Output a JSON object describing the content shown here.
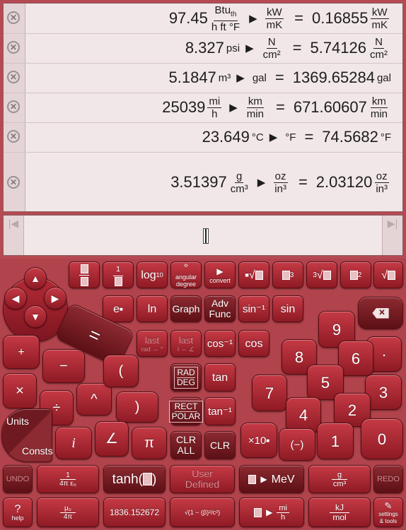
{
  "history": [
    {
      "value": "97.45",
      "from_num": "Btu",
      "from_num_sub": "th",
      "from_den": "h ft °F",
      "to_num": "kW",
      "to_den": "mK",
      "result": "0.16855",
      "res_num": "kW",
      "res_den": "mK"
    },
    {
      "value": "8.327",
      "from_unit": "psi",
      "to_num": "N",
      "to_den": "cm²",
      "result": "5.74126",
      "res_num": "N",
      "res_den": "cm²"
    },
    {
      "value": "5.1847",
      "from_unit": "m³",
      "to_unit": "gal",
      "result": "1369.65284",
      "res_unit": "gal"
    },
    {
      "value": "25039",
      "from_num": "mi",
      "from_den": "h",
      "to_num": "km",
      "to_den": "min",
      "result": "671.60607",
      "res_num": "km",
      "res_den": "min"
    },
    {
      "value": "23.649",
      "from_unit": "°C",
      "to_unit": "°F",
      "result": "74.5682",
      "res_unit": "°F"
    },
    {
      "value": "3.51397",
      "from_num": "g",
      "from_den": "cm³",
      "to_num": "oz",
      "to_den": "in³",
      "result": "2.03120",
      "res_num": "oz",
      "res_den": "in³"
    }
  ],
  "symbols": {
    "arrow": "▶",
    "equals": "=",
    "delete": "✕",
    "nav_left": "|◀",
    "nav_right": "▶|"
  },
  "keys": {
    "row1": [
      "log10",
      "angular degree",
      "convert"
    ],
    "log": "log",
    "log_sub": "10",
    "angular": "°",
    "angular_label": "angular degree",
    "convert_arrow": "▶",
    "convert": "convert",
    "e": "e",
    "ln": "ln",
    "graph": "Graph",
    "adv1": "Adv",
    "adv2": "Func",
    "asin": "sin⁻¹",
    "sin": "sin",
    "last1": "last",
    "last1_sub": "rad ⇔ °",
    "last2": "last",
    "last2_sub": "i ⇔ ∠",
    "acos": "cos⁻¹",
    "cos": "cos",
    "rad": "RAD",
    "deg": "DEG",
    "tan": "tan",
    "rect": "RECT",
    "polar": "POLAR",
    "atan": "tan⁻¹",
    "clr_all1": "CLR",
    "clr_all2": "ALL",
    "clr": "CLR",
    "plus": "+",
    "minus": "−",
    "times": "×",
    "divide": "÷",
    "equals": "=",
    "open_paren": "(",
    "close_paren": ")",
    "caret": "^",
    "imag": "i",
    "angle": "∠",
    "pi": "π",
    "units": "Units",
    "consts": "Consts",
    "d9": "9",
    "d8": "8",
    "d7": "7",
    "d6": "6",
    "d5": "5",
    "d4": "4",
    "d3": "3",
    "d2": "2",
    "d1": "1",
    "d0": "0",
    "dot": "·",
    "exp": "×10",
    "neg": "(−)",
    "undo": "UNDO",
    "redo": "REDO",
    "const1_num": "1",
    "const1_den": "4π ε₀",
    "tanh": "tanh(",
    "user1": "User",
    "user2": "Defined",
    "mev": "MeV",
    "gcm_num": "g",
    "gcm_den": "cm³",
    "help_q": "?",
    "help": "help",
    "mu_num": "μ₀",
    "mu_den": "4π",
    "mass_ratio": "1836.152672",
    "lorentz": "√(1 − (β)²/c²)",
    "mih_num": "mi",
    "mih_den": "h",
    "kj_num": "kJ",
    "kj_den": "mol",
    "settings1": "settings",
    "settings2": "& tools"
  }
}
